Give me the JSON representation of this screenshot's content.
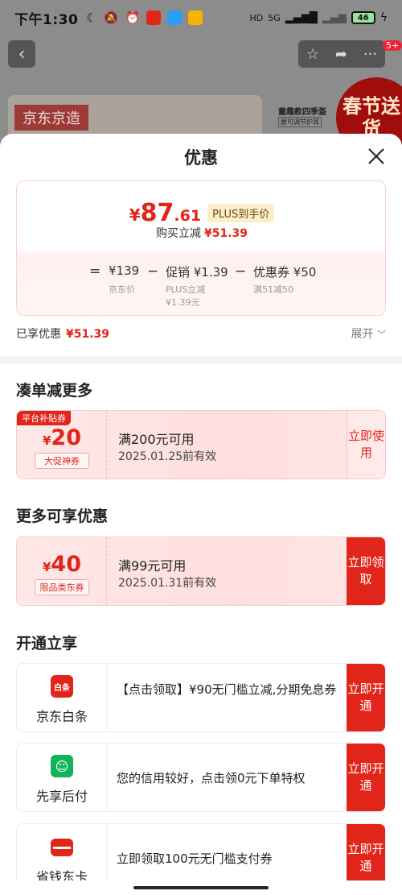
{
  "status_bar": {
    "time": "下午1:30",
    "network": "5G",
    "battery": "46"
  },
  "background_page": {
    "brand_label": "京东京造",
    "promo_text": "童趣款四季盔",
    "promo_sub": "腰可调节护耳",
    "festival_text": "春节送货",
    "badge": "5+"
  },
  "sheet": {
    "title": "优惠",
    "price": {
      "currency": "¥",
      "integer": "87",
      "decimal": ".61",
      "tag": "PLUS到手价",
      "buy_reduce_label": "购买立减",
      "buy_reduce_value": "¥51.39"
    },
    "calculation": {
      "eq": "=",
      "base": "¥139",
      "base_label": "京东价",
      "minus1": "−",
      "promo": "促销 ¥1.39",
      "promo_label1": "PLUS立减",
      "promo_label2": "¥1.39元",
      "minus2": "−",
      "coupon": "优惠券 ¥50",
      "coupon_label": "满51减50"
    },
    "enjoyed_label": "已享优惠",
    "enjoyed_value": "¥51.39",
    "expand_label": "展开"
  },
  "sections": {
    "more_discount": "凑单减更多",
    "more_offers": "更多可享优惠",
    "open_now": "开通立享"
  },
  "coupons": [
    {
      "corner": "平台补贴券",
      "currency": "¥",
      "amount": "20",
      "tag": "大促神券",
      "condition": "满200元可用",
      "expire": "2025.01.25前有效",
      "action": "立即使用"
    },
    {
      "currency": "¥",
      "amount": "40",
      "tag": "限品类东券",
      "condition": "满99元可用",
      "expire": "2025.01.31前有效",
      "action": "立即领取"
    }
  ],
  "open_cards": [
    {
      "name": "京东白条",
      "logo_text": "白条",
      "desc": "【点击领取】¥90无门槛立减,分期免息券",
      "action": "立即开通"
    },
    {
      "name": "先享后付",
      "desc": "您的信用较好，点击领0元下单特权",
      "action": "立即开通"
    },
    {
      "name": "省钱东卡",
      "desc": "立即领取100元无门槛支付券",
      "action": "立即开通"
    }
  ],
  "colors": {
    "accent": "#e1251b",
    "plus_tag_bg": "#fbeec9"
  }
}
